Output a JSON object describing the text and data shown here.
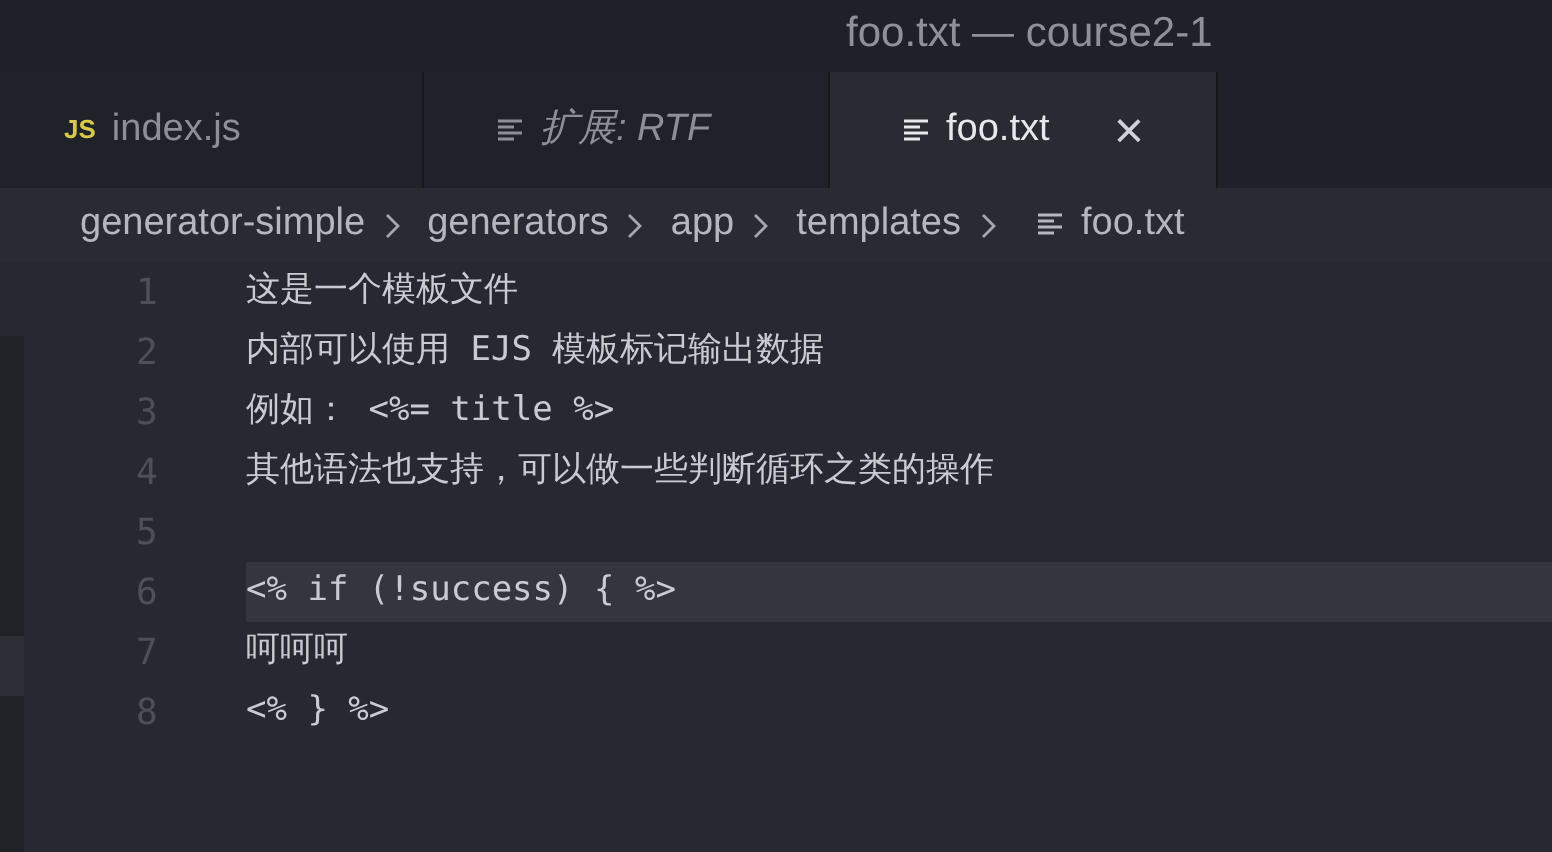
{
  "window": {
    "title": "foo.txt — course2-1"
  },
  "tabs": [
    {
      "label": "index.js",
      "kind": "js",
      "icon_text": "JS",
      "selected": false,
      "preview": false
    },
    {
      "label": "扩展: RTF",
      "kind": "text",
      "selected": false,
      "preview": true
    },
    {
      "label": "foo.txt",
      "kind": "text",
      "selected": true,
      "preview": false,
      "close": "×"
    }
  ],
  "breadcrumb": [
    {
      "label": "generator-simple",
      "kind": "folder"
    },
    {
      "label": "generators",
      "kind": "folder"
    },
    {
      "label": "app",
      "kind": "folder"
    },
    {
      "label": "templates",
      "kind": "folder"
    },
    {
      "label": "foo.txt",
      "kind": "file"
    }
  ],
  "editor": {
    "lines": [
      {
        "number": "1",
        "text": "这是一个模板文件",
        "current": false
      },
      {
        "number": "2",
        "text": "内部可以使用 EJS 模板标记输出数据",
        "current": false
      },
      {
        "number": "3",
        "text": "例如： <%= title %>",
        "current": false
      },
      {
        "number": "4",
        "text": "其他语法也支持，可以做一些判断循环之类的操作",
        "current": false
      },
      {
        "number": "5",
        "current": false
      },
      {
        "number": "6",
        "text": "<% if (!success) { %>",
        "current": true
      },
      {
        "number": "7",
        "text": "呵呵呵",
        "current": false
      },
      {
        "number": "8",
        "text": "<% } %>",
        "current": false
      }
    ]
  }
}
